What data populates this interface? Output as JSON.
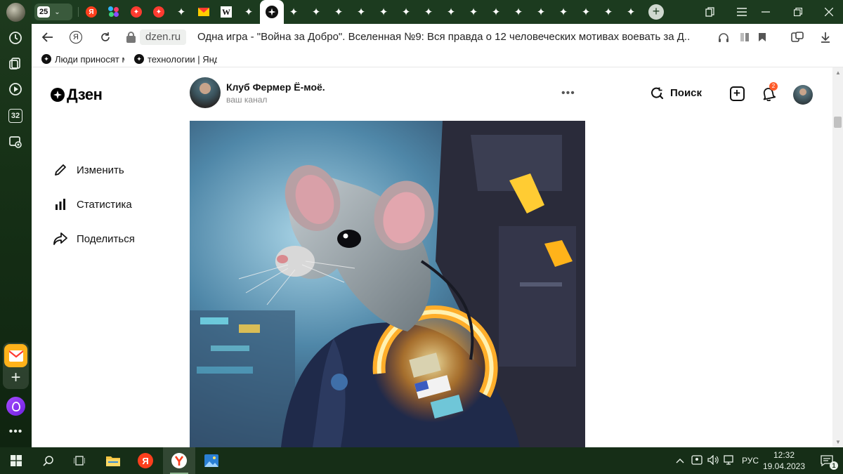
{
  "browser": {
    "tab_counter": "25",
    "bookmark_short": "Я",
    "active_tab_title": "Одна игра - \"Война за Добро\". Вселенная №9: Вся правда о 12 человеческих мотивах воевать за Д...",
    "domain": "dzen.ru",
    "sidebar_calendar_day": "32"
  },
  "bookmarks": [
    {
      "label": "Люди приносят м",
      "fade": "ые"
    },
    {
      "label": "технологии | Янд",
      "fade": "е"
    }
  ],
  "dzen": {
    "logo_text": "Дзен",
    "channel_name": "Клуб Фермер Ё-моё.",
    "channel_sub": "ваш канал",
    "search_label": "Поиск",
    "notifications_count": "2",
    "menu": [
      {
        "label": "Изменить",
        "icon": "pencil-icon"
      },
      {
        "label": "Статистика",
        "icon": "bar-chart-icon"
      },
      {
        "label": "Поделиться",
        "icon": "share-icon"
      }
    ]
  },
  "taskbar": {
    "language": "РУС",
    "time": "12:32",
    "date": "19.04.2023",
    "notification_count": "1"
  },
  "colors": {
    "browser_chrome": "#1c3b1f",
    "yandex_red": "#fc3f1d",
    "notification_badge": "#ff5c2b",
    "mail_yellow": "#ffb21a",
    "alice_purple": "#8a35f0"
  }
}
